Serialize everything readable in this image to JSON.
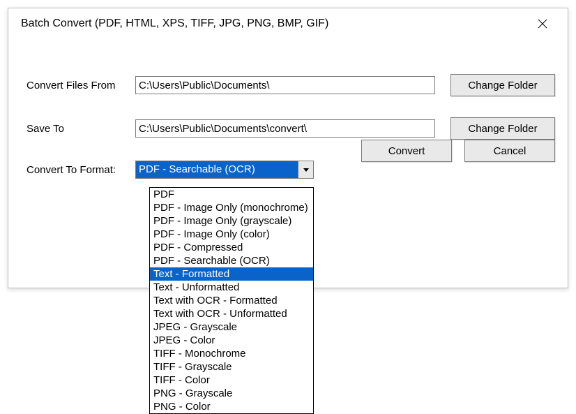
{
  "window": {
    "title": "Batch Convert (PDF, HTML, XPS, TIFF, JPG, PNG, BMP, GIF)"
  },
  "labels": {
    "convert_from": "Convert Files From",
    "save_to": "Save To",
    "convert_format": "Convert To Format:"
  },
  "fields": {
    "from_path": "C:\\Users\\Public\\Documents\\",
    "save_path": "C:\\Users\\Public\\Documents\\convert\\"
  },
  "buttons": {
    "change_folder": "Change Folder",
    "convert": "Convert",
    "cancel": "Cancel"
  },
  "format_select": {
    "selected": "PDF - Searchable (OCR)",
    "highlighted_index": 6,
    "options": [
      "PDF",
      "PDF - Image Only (monochrome)",
      "PDF - Image Only (grayscale)",
      "PDF - Image Only (color)",
      "PDF - Compressed",
      "PDF - Searchable (OCR)",
      "Text - Formatted",
      "Text - Unformatted",
      "Text with OCR - Formatted",
      "Text with OCR - Unformatted",
      "JPEG - Grayscale",
      "JPEG - Color",
      "TIFF - Monochrome",
      "TIFF - Grayscale",
      "TIFF - Color",
      "PNG - Grayscale",
      "PNG - Color"
    ]
  }
}
